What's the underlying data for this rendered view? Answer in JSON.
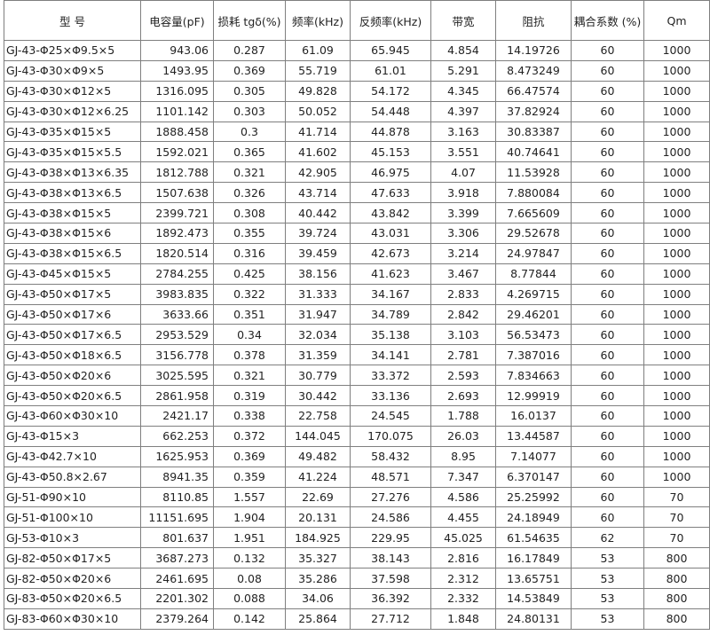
{
  "table": {
    "headers": [
      "型 号",
      "电容量(pF)",
      "损耗 tgδ(%)",
      "频率(kHz)",
      "反频率(kHz)",
      "带宽",
      "阻抗",
      "耦合系数 (%)",
      "Qm"
    ],
    "rows": [
      [
        "GJ-43-Φ25×Φ9.5×5",
        "943.06",
        "0.287",
        "61.09",
        "65.945",
        "4.854",
        "14.19726",
        "60",
        "1000"
      ],
      [
        "GJ-43-Φ30×Φ9×5",
        "1493.95",
        "0.369",
        "55.719",
        "61.01",
        "5.291",
        "8.473249",
        "60",
        "1000"
      ],
      [
        "GJ-43-Φ30×Φ12×5",
        "1316.095",
        "0.305",
        "49.828",
        "54.172",
        "4.345",
        "66.47574",
        "60",
        "1000"
      ],
      [
        "GJ-43-Φ30×Φ12×6.25",
        "1101.142",
        "0.303",
        "50.052",
        "54.448",
        "4.397",
        "37.82924",
        "60",
        "1000"
      ],
      [
        "GJ-43-Φ35×Φ15×5",
        "1888.458",
        "0.3",
        "41.714",
        "44.878",
        "3.163",
        "30.83387",
        "60",
        "1000"
      ],
      [
        "GJ-43-Φ35×Φ15×5.5",
        "1592.021",
        "0.365",
        "41.602",
        "45.153",
        "3.551",
        "40.74641",
        "60",
        "1000"
      ],
      [
        "GJ-43-Φ38×Φ13×6.35",
        "1812.788",
        "0.321",
        "42.905",
        "46.975",
        "4.07",
        "11.53928",
        "60",
        "1000"
      ],
      [
        "GJ-43-Φ38×Φ13×6.5",
        "1507.638",
        "0.326",
        "43.714",
        "47.633",
        "3.918",
        "7.880084",
        "60",
        "1000"
      ],
      [
        "GJ-43-Φ38×Φ15×5",
        "2399.721",
        "0.308",
        "40.442",
        "43.842",
        "3.399",
        "7.665609",
        "60",
        "1000"
      ],
      [
        "GJ-43-Φ38×Φ15×6",
        "1892.473",
        "0.355",
        "39.724",
        "43.031",
        "3.306",
        "29.52678",
        "60",
        "1000"
      ],
      [
        "GJ-43-Φ38×Φ15×6.5",
        "1820.514",
        "0.316",
        "39.459",
        "42.673",
        "3.214",
        "24.97847",
        "60",
        "1000"
      ],
      [
        "GJ-43-Φ45×Φ15×5",
        "2784.255",
        "0.425",
        "38.156",
        "41.623",
        "3.467",
        "8.77844",
        "60",
        "1000"
      ],
      [
        "GJ-43-Φ50×Φ17×5",
        "3983.835",
        "0.322",
        "31.333",
        "34.167",
        "2.833",
        "4.269715",
        "60",
        "1000"
      ],
      [
        "GJ-43-Φ50×Φ17×6",
        "3633.66",
        "0.351",
        "31.947",
        "34.789",
        "2.842",
        "29.46201",
        "60",
        "1000"
      ],
      [
        "GJ-43-Φ50×Φ17×6.5",
        "2953.529",
        "0.34",
        "32.034",
        "35.138",
        "3.103",
        "56.53473",
        "60",
        "1000"
      ],
      [
        "GJ-43-Φ50×Φ18×6.5",
        "3156.778",
        "0.378",
        "31.359",
        "34.141",
        "2.781",
        "7.387016",
        "60",
        "1000"
      ],
      [
        "GJ-43-Φ50×Φ20×6",
        "3025.595",
        "0.321",
        "30.779",
        "33.372",
        "2.593",
        "7.834663",
        "60",
        "1000"
      ],
      [
        "GJ-43-Φ50×Φ20×6.5",
        "2861.958",
        "0.319",
        "30.442",
        "33.136",
        "2.693",
        "12.99919",
        "60",
        "1000"
      ],
      [
        "GJ-43-Φ60×Φ30×10",
        "2421.17",
        "0.338",
        "22.758",
        "24.545",
        "1.788",
        "16.0137",
        "60",
        "1000"
      ],
      [
        "GJ-43-Φ15×3",
        "662.253",
        "0.372",
        "144.045",
        "170.075",
        "26.03",
        "13.44587",
        "60",
        "1000"
      ],
      [
        "GJ-43-Φ42.7×10",
        "1625.953",
        "0.369",
        "49.482",
        "58.432",
        "8.95",
        "7.14077",
        "60",
        "1000"
      ],
      [
        "GJ-43-Φ50.8×2.67",
        "8941.35",
        "0.359",
        "41.224",
        "48.571",
        "7.347",
        "6.370147",
        "60",
        "1000"
      ],
      [
        "GJ-51-Φ90×10",
        "8110.85",
        "1.557",
        "22.69",
        "27.276",
        "4.586",
        "25.25992",
        "60",
        "70"
      ],
      [
        "GJ-51-Φ100×10",
        "11151.695",
        "1.904",
        "20.131",
        "24.586",
        "4.455",
        "24.18949",
        "60",
        "70"
      ],
      [
        "GJ-53-Φ10×3",
        "801.637",
        "1.951",
        "184.925",
        "229.95",
        "45.025",
        "61.54635",
        "62",
        "70"
      ],
      [
        "GJ-82-Φ50×Φ17×5",
        "3687.273",
        "0.132",
        "35.327",
        "38.143",
        "2.816",
        "16.17849",
        "53",
        "800"
      ],
      [
        "GJ-82-Φ50×Φ20×6",
        "2461.695",
        "0.08",
        "35.286",
        "37.598",
        "2.312",
        "13.65751",
        "53",
        "800"
      ],
      [
        "GJ-83-Φ50×Φ20×6.5",
        "2201.302",
        "0.088",
        "34.06",
        "36.392",
        "2.332",
        "14.53849",
        "53",
        "800"
      ],
      [
        "GJ-83-Φ60×Φ30×10",
        "2379.264",
        "0.142",
        "25.864",
        "27.712",
        "1.848",
        "24.80131",
        "53",
        "800"
      ]
    ]
  }
}
